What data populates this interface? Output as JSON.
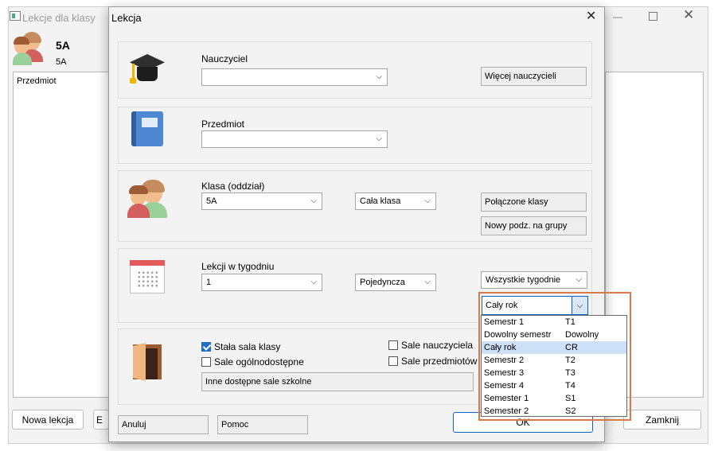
{
  "parent_window": {
    "title": "Lekcje dla klasy",
    "class_name": "5A",
    "class_sub": "5A",
    "list_header": "Przedmiot",
    "new_lesson_button": "Nowa lekcja",
    "partial_button": "E",
    "close_button": "Zamknij"
  },
  "dialog": {
    "title": "Lekcja",
    "teacher": {
      "label": "Nauczyciel",
      "value": "",
      "more_button": "Więcej nauczycieli"
    },
    "subject": {
      "label": "Przedmiot",
      "value": ""
    },
    "class_section": {
      "label": "Klasa (oddział)",
      "class_value": "5A",
      "group_value": "Cała klasa",
      "joined_button": "Połączone klasy",
      "new_split_button": "Nowy podz. na grupy"
    },
    "lessons": {
      "label": "Lekcji w tygodniu",
      "count_value": "1",
      "type_value": "Pojedyncza",
      "weeks_value": "Wszystkie tygodnie",
      "term_value": "Cały rok"
    },
    "rooms": {
      "fixed_room": {
        "label": "Stała sala klasy",
        "checked": true
      },
      "common_rooms": {
        "label": "Sale ogólnodostępne",
        "checked": false
      },
      "teacher_rooms": {
        "label": "Sale nauczyciela",
        "checked": false
      },
      "subject_rooms": {
        "label": "Sale przedmiotów",
        "checked": false
      },
      "other_rooms": "Inne dostępne sale szkolne"
    },
    "cancel_button": "Anuluj",
    "help_button": "Pomoc",
    "ok_button": "OK"
  },
  "term_dropdown": {
    "selected": "Cały rok",
    "options": [
      {
        "name": "Semestr 1",
        "code": "T1"
      },
      {
        "name": "Dowolny semestr",
        "code": "Dowolny"
      },
      {
        "name": "Cały rok",
        "code": "CR",
        "selected": true
      },
      {
        "name": "Semestr 2",
        "code": "T2"
      },
      {
        "name": "Semestr 3",
        "code": "T3"
      },
      {
        "name": "Semestr 4",
        "code": "T4"
      },
      {
        "name": "Semester 1",
        "code": "S1"
      },
      {
        "name": "Semester 2",
        "code": "S2"
      }
    ]
  },
  "colors": {
    "highlight_frame": "#d97a4a",
    "checkbox_checked": "#1f6fc5",
    "selected_row": "#cde0f7"
  }
}
